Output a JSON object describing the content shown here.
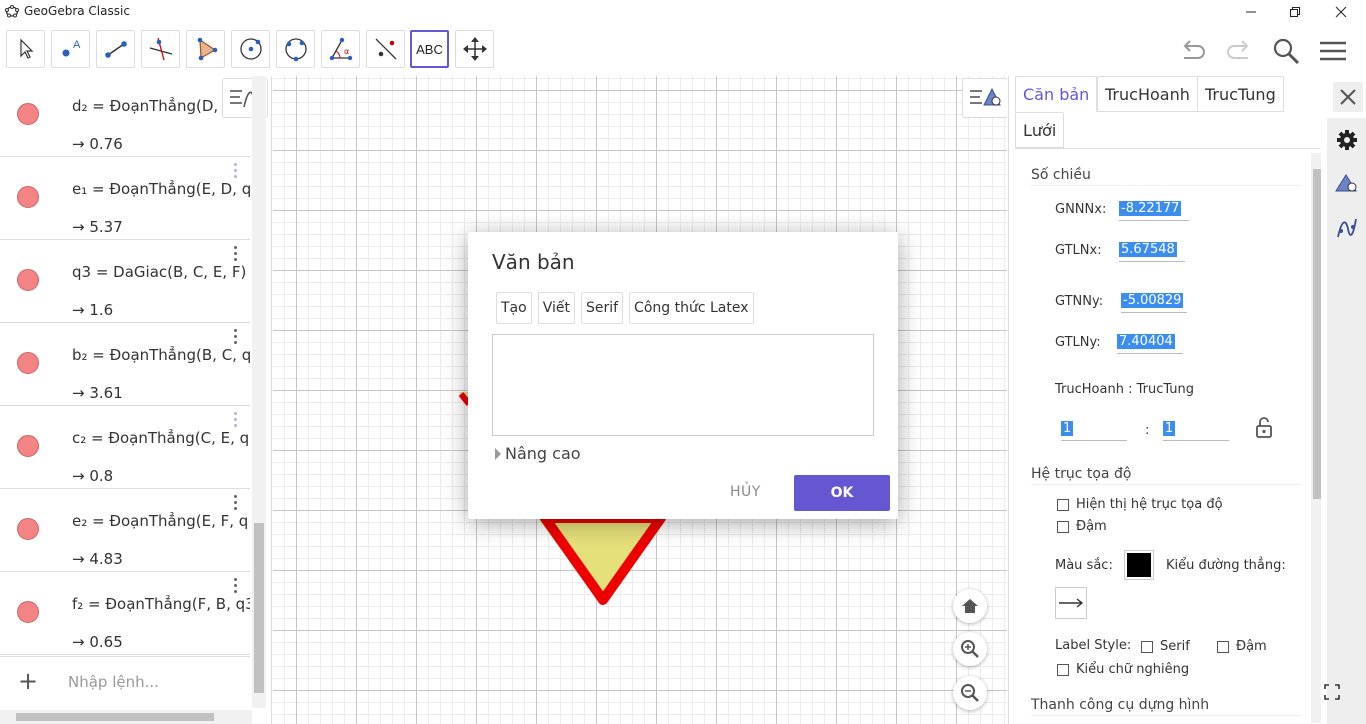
{
  "window": {
    "title": "GeoGebra Classic"
  },
  "toolbar": {
    "text_tool_label": "ABC"
  },
  "algebra": {
    "items": [
      {
        "def": "d₂ = ĐoạnThẳng(D, ",
        "value": "→  0.76"
      },
      {
        "def": "e₁ = ĐoạnThẳng(E, D, q",
        "value": "→  5.37"
      },
      {
        "def": "q3 = DaGiac(B, C, E, F)",
        "value": "→  1.6"
      },
      {
        "def": "b₂ = ĐoạnThẳng(B, C, q",
        "value": "→  3.61"
      },
      {
        "def": "c₂ = ĐoạnThẳng(C, E, q",
        "value": "→  0.8"
      },
      {
        "def": "e₂ = ĐoạnThẳng(E, F, q",
        "value": "→  4.83"
      },
      {
        "def": "f₂ = ĐoạnThẳng(F, B, q3",
        "value": "→  0.65"
      }
    ],
    "input_plus": "+",
    "input_placeholder": "Nhập lệnh..."
  },
  "dialog": {
    "title": "Văn bản",
    "tabs": [
      "Tạo",
      "Viết",
      "Serif",
      "Công thức Latex"
    ],
    "advanced_label": "Nâng cao",
    "cancel_label": "HỦY",
    "ok_label": "OK"
  },
  "properties": {
    "tabs": [
      "Căn bản",
      "TrucHoanh",
      "TrucTung",
      "Lưới"
    ],
    "dimensions_title": "Số chiều",
    "xmin_label": "GNNNx:",
    "xmin_value": "-8.22177",
    "xmax_label": "GTLNx:",
    "xmax_value": "5.67548",
    "ymin_label": "GTNNy:",
    "ymin_value": "-5.00829",
    "ymax_label": "GTLNy:",
    "ymax_value": "7.40404",
    "ratio_label": "TrucHoanh : TrucTung",
    "ratio_x": "1",
    "ratio_sep": ":",
    "ratio_y": "1",
    "axes_title": "Hệ trục tọa độ",
    "show_axes": "Hiện thị hệ trục tọa độ",
    "bold": "Đậm",
    "color_label": "Màu sắc:",
    "line_style_label": "Kiểu đường thẳng:",
    "label_style_label": "Label Style:",
    "serif": "Serif",
    "bold2": "Đậm",
    "italic": "Kiểu chữ nghiêng",
    "toolbar_title": "Thanh công cụ dựng hình"
  },
  "colors": {
    "accent": "#6557d2",
    "point_fill": "#f48484",
    "highlight": "#3b8df0"
  }
}
